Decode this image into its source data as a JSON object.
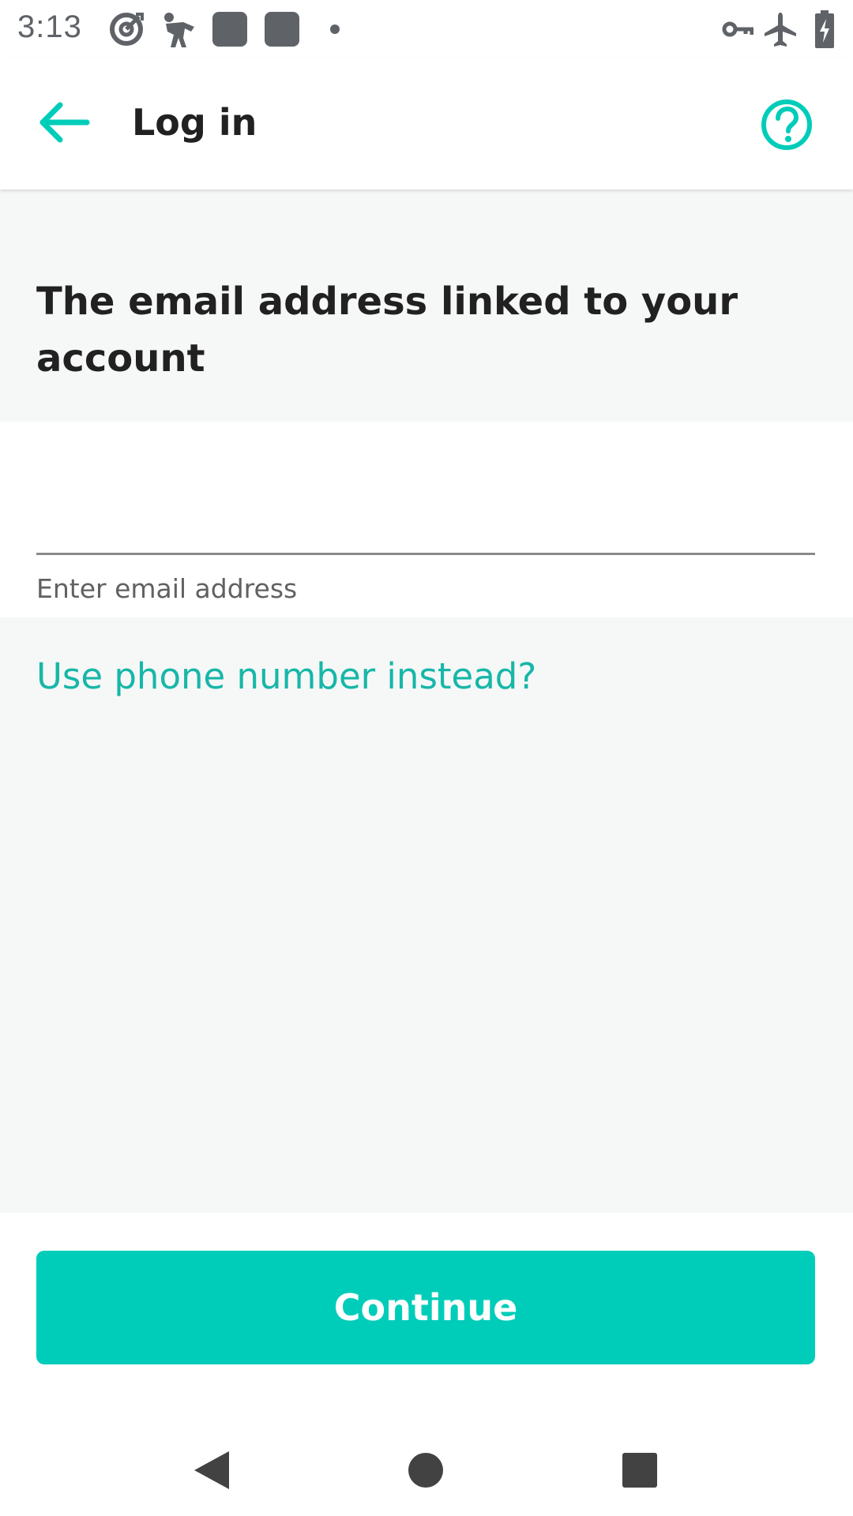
{
  "status_bar": {
    "time": "3:13",
    "left_icons": [
      "target-icon",
      "runner-icon",
      "app-square-icon",
      "app-square-icon",
      "dot-icon"
    ],
    "right_icons": [
      "vpn-key-icon",
      "airplane-icon",
      "battery-charging-icon"
    ]
  },
  "app_bar": {
    "back_icon": "arrow-left-icon",
    "title": "Log in",
    "help_icon": "help-circle-icon"
  },
  "main": {
    "heading": "The email address linked to your account",
    "email_field": {
      "value": "",
      "placeholder": "",
      "helper_text": "Enter email address"
    },
    "alternate_link": "Use phone number instead?",
    "continue_label": "Continue"
  },
  "nav_bar": {
    "buttons": [
      "back-triangle-icon",
      "home-circle-icon",
      "recents-square-icon"
    ]
  },
  "colors": {
    "accent": "#00cdb9",
    "link": "#16b7a8",
    "section_bg": "#f6f7f7",
    "text": "#212121"
  }
}
